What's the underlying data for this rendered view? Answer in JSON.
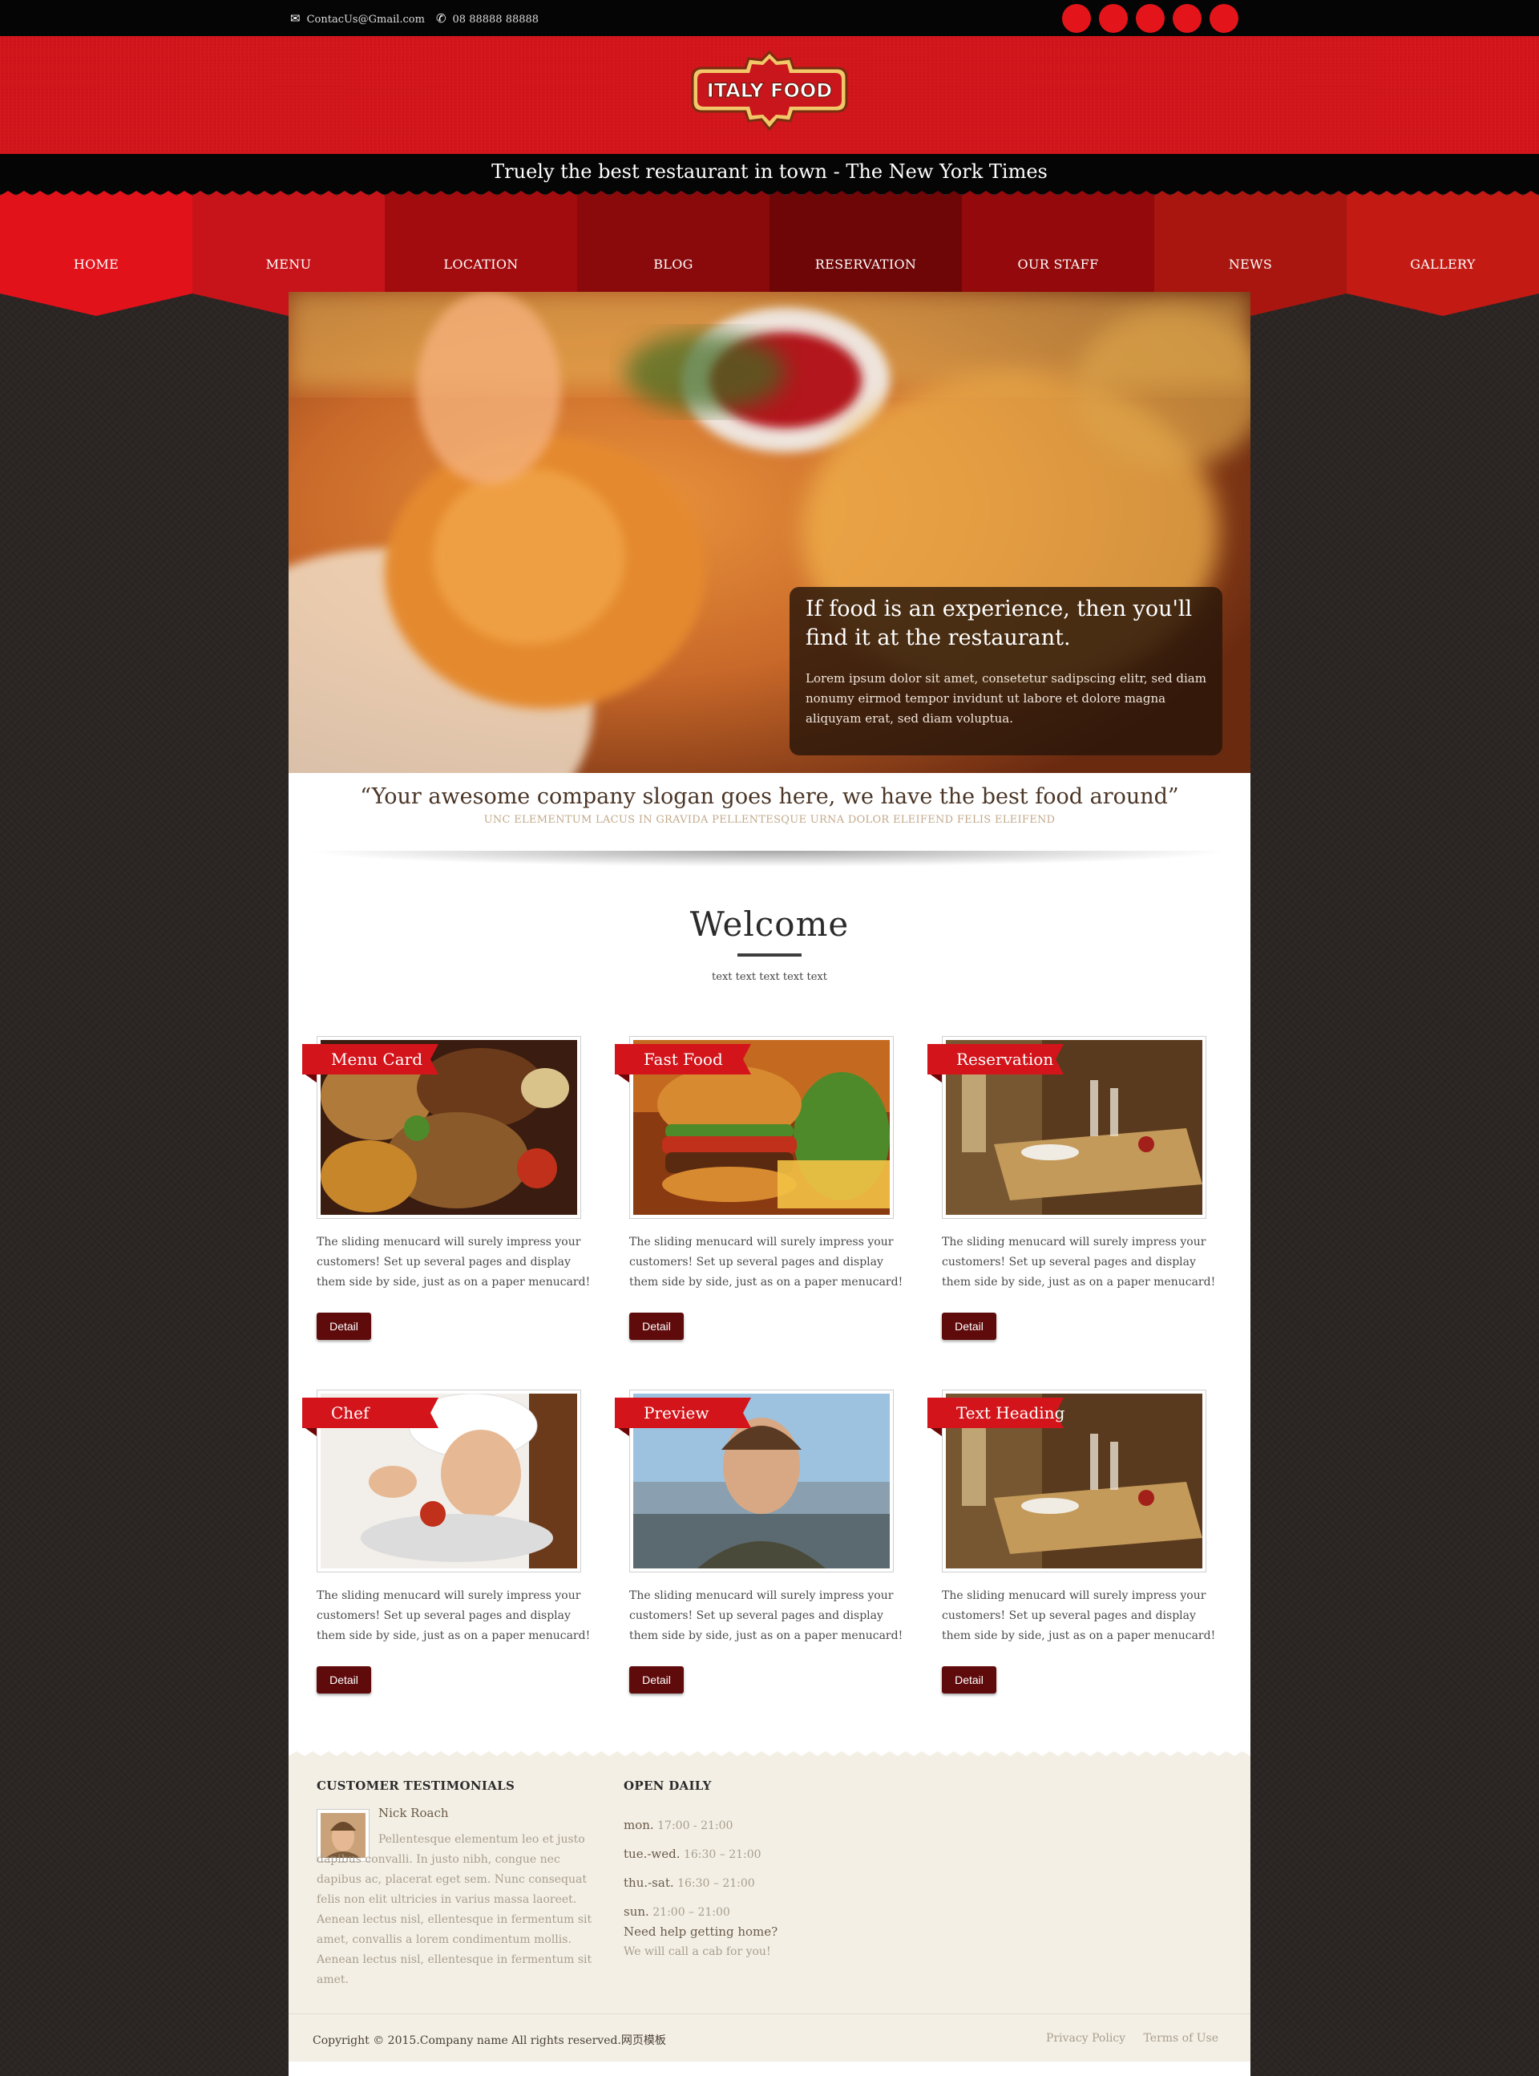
{
  "topbar": {
    "email_icon": "envelope-icon",
    "email": "ContacUs@Gmail.com",
    "phone_icon": "phone-icon",
    "phone": "08 88888 88888",
    "social_count": 5
  },
  "logo": {
    "text": "ITALY FOOD"
  },
  "tagline": "Truely the best restaurant in town - The New York Times",
  "nav": [
    {
      "label": "HOME",
      "color": "#e2121b"
    },
    {
      "label": "MENU",
      "color": "#c7141a"
    },
    {
      "label": "LOCATION",
      "color": "#a20c0f"
    },
    {
      "label": "BLOG",
      "color": "#8a0a0c"
    },
    {
      "label": "RESERVATION",
      "color": "#6e0607"
    },
    {
      "label": "OUR STAFF",
      "color": "#940a0c"
    },
    {
      "label": "NEWS",
      "color": "#a8160f"
    },
    {
      "label": "GALLERY",
      "color": "#c31a14"
    }
  ],
  "hero": {
    "heading": "If food is an experience, then you'll find it at the restaurant.",
    "text": "Lorem ipsum dolor sit amet, consetetur sadipscing elitr, sed diam nonumy eirmod tempor invidunt ut labore et dolore magna aliquyam erat, sed diam voluptua."
  },
  "slogan": {
    "quote": "“Your awesome company slogan goes here, we have the best food around”",
    "sub": "UNC ELEMENTUM LACUS IN GRAVIDA PELLENTESQUE URNA DOLOR ELEIFEND FELIS ELEIFEND"
  },
  "welcome": {
    "title": "Welcome",
    "sub": "text text text text text"
  },
  "cards": [
    {
      "title": "Menu Card",
      "text": "The sliding menucard will surely impress your customers! Set up several pages and display them side by side, just as on a paper menucard!",
      "button": "Detail"
    },
    {
      "title": "Fast Food",
      "text": "The sliding menucard will surely impress your customers! Set up several pages and display them side by side, just as on a paper menucard!",
      "button": "Detail"
    },
    {
      "title": "Reservation",
      "text": "The sliding menucard will surely impress your customers! Set up several pages and display them side by side, just as on a paper menucard!",
      "button": "Detail"
    },
    {
      "title": "Chef",
      "text": "The sliding menucard will surely impress your customers! Set up several pages and display them side by side, just as on a paper menucard!",
      "button": "Detail"
    },
    {
      "title": "Preview",
      "text": "The sliding menucard will surely impress your customers! Set up several pages and display them side by side, just as on a paper menucard!",
      "button": "Detail"
    },
    {
      "title": "Text Heading",
      "text": "The sliding menucard will surely impress your customers! Set up several pages and display them side by side, just as on a paper menucard!",
      "button": "Detail"
    }
  ],
  "footer": {
    "testimonials_title": "CUSTOMER TESTIMONIALS",
    "testimonial_name": "Nick Roach",
    "testimonial_text": "Pellentesque elementum leo et justo dapibus convalli. In justo nibh, congue nec dapibus ac, placerat eget sem. Nunc consequat felis non elit ultricies in varius massa laoreet. Aenean lectus nisl, ellentesque in fermentum sit amet, convallis a lorem condimentum mollis. Aenean lectus nisl, ellentesque in fermentum sit amet.",
    "hours_title": "OPEN DAILY",
    "hours": [
      {
        "day": "mon.",
        "time": "17:00 - 21:00"
      },
      {
        "day": "tue.-wed.",
        "time": "16:30 – 21:00"
      },
      {
        "day": "thu.-sat.",
        "time": "16:30 – 21:00"
      },
      {
        "day": "sun.",
        "time": "21:00 – 21:00"
      }
    ],
    "help_title": "Need help getting home?",
    "help_text": "We will call a cab for you!"
  },
  "bottom": {
    "copyright": "Copyright © 2015.Company name All rights reserved.网页模板",
    "privacy": "Privacy Policy",
    "terms": "Terms of Use"
  }
}
